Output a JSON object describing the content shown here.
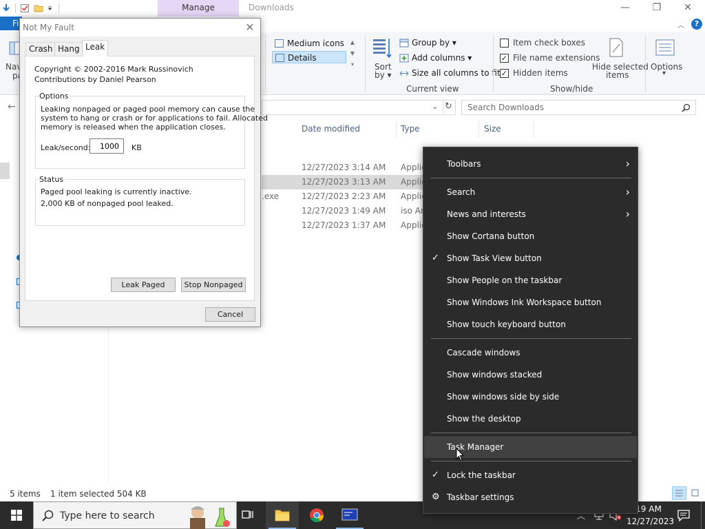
{
  "explorer": {
    "window_title": "Downloads",
    "manage_tab": "Manage",
    "file_tab": "Fi",
    "help": "?",
    "controls": {
      "minimize": "—",
      "maximize": "❐",
      "close": "✕"
    },
    "ribbon": {
      "nav_label_1": "Navi",
      "nav_label_2": "pa",
      "layout": {
        "medium_icons": "Medium icons",
        "details": "Details"
      },
      "sort_by_1": "Sort",
      "sort_by_2": "by ▾",
      "group_by": "Group by ▾",
      "add_columns": "Add columns ▾",
      "size_all_columns": "Size all columns to fit",
      "current_view": "Current view",
      "item_check_boxes": "Item check boxes",
      "file_name_extensions": "File name extensions",
      "hidden_items": "Hidden items",
      "hide_selected_1": "Hide selected",
      "hide_selected_2": "items",
      "show_hide": "Show/hide",
      "options": "Options",
      "options_arrow": "▾",
      "checks": {
        "item_check_boxes": false,
        "file_name_extensions": true,
        "hidden_items": true
      }
    },
    "search_placeholder": "Search Downloads",
    "columns": {
      "date_modified": "Date modified",
      "type": "Type",
      "size": "Size"
    },
    "rows": [
      {
        "name": "",
        "date": "12/27/2023 3:14 AM",
        "type": "Applic"
      },
      {
        "name": "",
        "date": "12/27/2023 3:13 AM",
        "type": "Applic"
      },
      {
        "name": ".exe",
        "date": "12/27/2023 2:23 AM",
        "type": "Applic"
      },
      {
        "name": "",
        "date": "12/27/2023 1:49 AM",
        "type": "iso Ar"
      },
      {
        "name": "",
        "date": "12/27/2023 1:37 AM",
        "type": "Applic"
      }
    ],
    "status": {
      "items": "5 items",
      "selected": "1 item selected  504 KB"
    }
  },
  "nmf": {
    "title": "Not My Fault",
    "close": "✕",
    "tabs": [
      "Crash",
      "Hang",
      "Leak"
    ],
    "copyright": "Copyright © 2002-2016 Mark Russinovich",
    "contributions": "Contributions by Daniel Pearson",
    "options_title": "Options",
    "options_text_1": "Leaking nonpaged or paged pool memory can cause the",
    "options_text_2": "system to hang or crash or for applications to fail. Allocated",
    "options_text_3": "memory is released when the application closes.",
    "leak_label": "Leak/second:",
    "leak_value": "1000",
    "leak_unit": "KB",
    "status_title": "Status",
    "status_1": "Paged pool leaking is currently inactive.",
    "status_2": "2,000 KB of nonpaged pool leaked.",
    "leak_paged": "Leak Paged",
    "stop_nonpaged": "Stop Nonpaged",
    "cancel": "Cancel"
  },
  "taskbar": {
    "search_placeholder": "Type here to search",
    "time": "19 AM",
    "date": "12/27/2023"
  },
  "context_menu": {
    "items": [
      {
        "label": "Toolbars",
        "submenu": true
      },
      {
        "label": "Search",
        "submenu": true
      },
      {
        "label": "News and interests",
        "submenu": true
      },
      {
        "label": "Show Cortana button"
      },
      {
        "label": "Show Task View button",
        "checked": true
      },
      {
        "label": "Show People on the taskbar"
      },
      {
        "label": "Show Windows Ink Workspace button"
      },
      {
        "label": "Show touch keyboard button"
      },
      {
        "label": "Cascade windows"
      },
      {
        "label": "Show windows stacked"
      },
      {
        "label": "Show windows side by side"
      },
      {
        "label": "Show the desktop"
      },
      {
        "label": "Task Manager",
        "hover": true
      },
      {
        "label": "Lock the taskbar",
        "checked": true
      },
      {
        "label": "Taskbar settings",
        "gear": true
      }
    ],
    "arrow": "›",
    "check": "✓",
    "gear": "⚙"
  },
  "colors": {
    "accent": "#1a6fc7",
    "menu_bg": "#2b2b2b",
    "menu_hover": "#414141",
    "manage_tab": "#e7d7f7"
  }
}
